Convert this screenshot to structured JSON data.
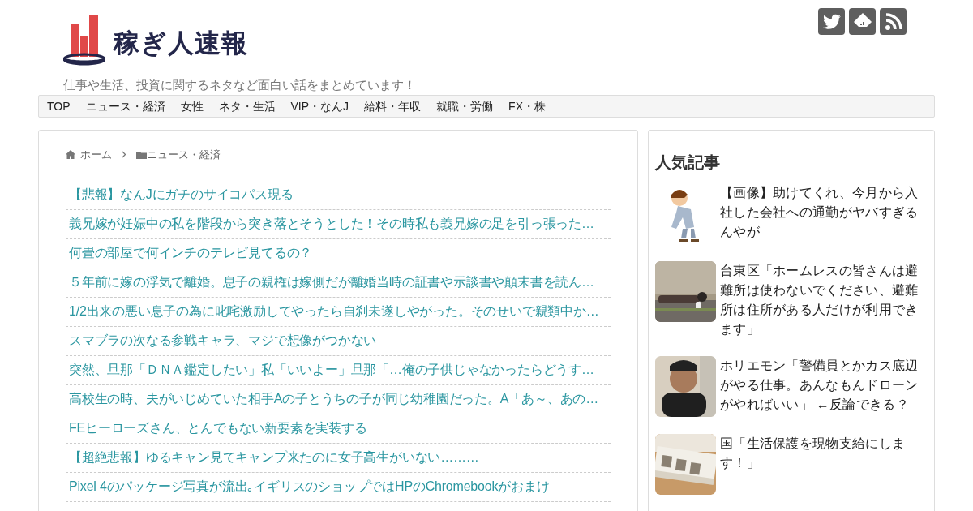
{
  "site": {
    "title": "稼ぎ人速報",
    "tagline": "仕事や生活、投資に関するネタなど面白い話をまとめています！"
  },
  "nav": [
    "TOP",
    "ニュース・経済",
    "女性",
    "ネタ・生活",
    "VIP・なんJ",
    "給料・年収",
    "就職・労働",
    "FX・株"
  ],
  "breadcrumb": [
    "ホーム",
    "ニュース・経済"
  ],
  "articles": [
    "【悲報】なんJにガチのサイコパス現る",
    "義兄嫁が妊娠中の私を階段から突き落とそうとした！その時私も義兄嫁の足を引っ張った…",
    "何畳の部屋で何インチのテレビ見てるの？",
    "５年前に嫁の浮気で離婚。息子の親権は嫁側だが離婚当時の証書や示談書や顛末書を読ん…",
    "1/2出来の悪い息子の為に叱咤激励してやったら自刹未遂しやがった。そのせいで親類中か…",
    "スマブラの次なる参戦キャラ、マジで想像がつかない",
    "突然、旦那「ＤＮＡ鑑定したい」私「いいよー」旦那「…俺の子供じゃなかったらどうす…",
    "高校生の時、夫がいじめていた相手Aの子とうちの子が同じ幼稚園だった。A「あ～、あの…",
    "FEヒーローズさん、とんでもない新要素を実装する",
    "【超絶悲報】ゆるキャン見てキャンプ来たのに女子高生がいない………",
    "Pixel 4のパッケージ写真が流出｡イギリスのショップではHPのChromebookがおまけ"
  ],
  "sidebar": {
    "title": "人気記事",
    "items": [
      {
        "kind": "illustration",
        "title": "【画像】助けてくれ、今月から入社した会社への通勤がヤバすぎるんやが"
      },
      {
        "kind": "picture",
        "title": "台東区「ホームレスの皆さんは避難所は使わないでください、避難所は住所がある人だけが利用できます」"
      },
      {
        "kind": "picture",
        "title": "ホリエモン「警備員とかカス底辺がやる仕事。あんなもんドローンがやればいい」 ←反論できる？"
      },
      {
        "kind": "picture",
        "title": "国「生活保護を現物支給にします！」"
      }
    ]
  }
}
